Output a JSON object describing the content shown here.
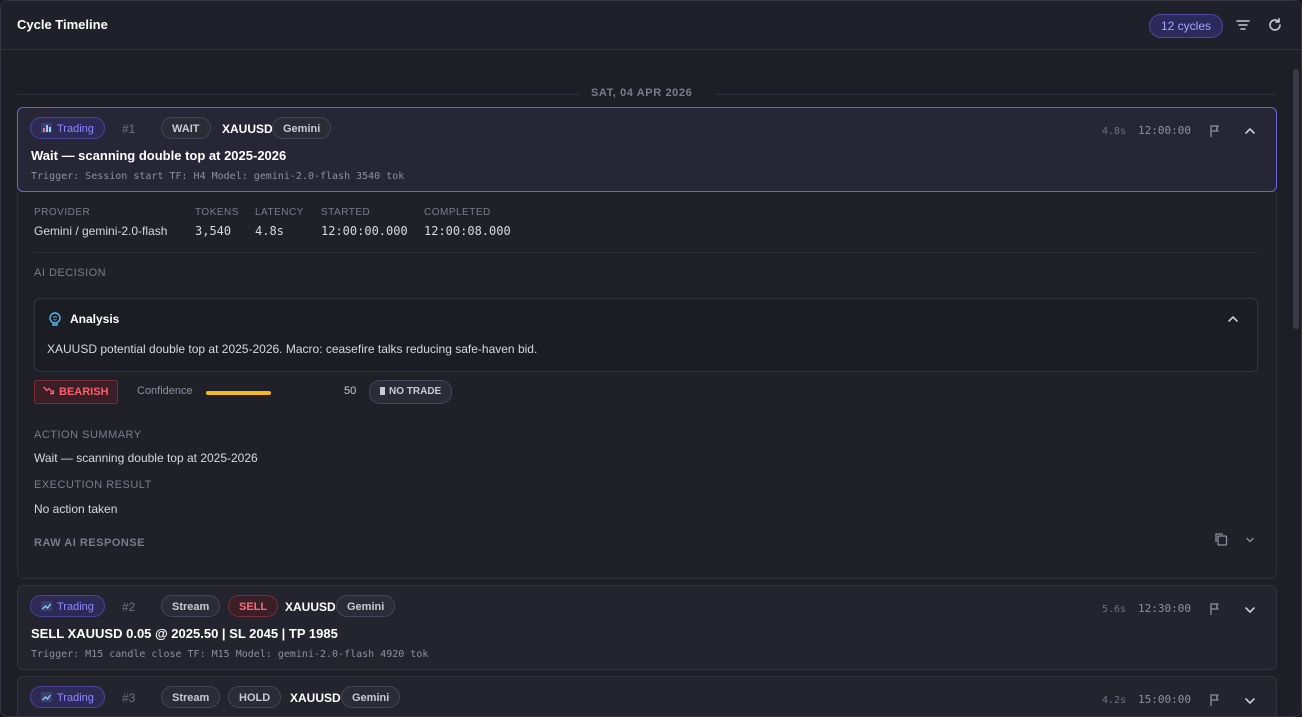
{
  "header": {
    "title": "Cycle Timeline",
    "cycles_badge": "12 cycles"
  },
  "date_divider": "SAT, 04 APR 2026",
  "cycles": [
    {
      "type": "Trading",
      "type_icon": "bar-chart-icon",
      "index": "#1",
      "badges": [
        "WAIT"
      ],
      "symbol": "XAUUSD",
      "provider": "Gemini",
      "title": "Wait — scanning double top at 2025-2026",
      "meta": "Trigger: Session start  TF: H4  Model: gemini-2.0-flash  3540 tok",
      "latency": "4.8s",
      "time": "12:00:00"
    },
    {
      "type": "Trading",
      "type_icon": "trend-chart-icon",
      "index": "#2",
      "badges": [
        "Stream",
        "SELL"
      ],
      "symbol": "XAUUSD",
      "provider": "Gemini",
      "title": "SELL XAUUSD 0.05 @ 2025.50 | SL 2045 | TP 1985",
      "meta": "Trigger: M15 candle close  TF: M15  Model: gemini-2.0-flash  4920 tok",
      "latency": "5.6s",
      "time": "12:30:00"
    },
    {
      "type": "Trading",
      "type_icon": "trend-chart-icon",
      "index": "#3",
      "badges": [
        "Stream",
        "HOLD"
      ],
      "symbol": "XAUUSD",
      "provider": "Gemini",
      "latency": "4.2s",
      "time": "15:00:00"
    }
  ],
  "details": {
    "labels": {
      "provider": "PROVIDER",
      "tokens": "TOKENS",
      "latency": "LATENCY",
      "started": "STARTED",
      "completed": "COMPLETED"
    },
    "provider": "Gemini / gemini-2.0-flash",
    "tokens": "3,540",
    "latency": "4.8s",
    "started": "12:00:00.000",
    "completed": "12:00:08.000",
    "ai_decision_label": "AI DECISION",
    "analysis_title": "Analysis",
    "analysis_text": "XAUUSD potential double top at 2025-2026. Macro: ceasefire talks reducing safe-haven bid.",
    "sentiment": "BEARISH",
    "confidence_label": "Confidence",
    "confidence_value": "50",
    "confidence_fraction": 0.5,
    "trade_status": "NO TRADE",
    "action_summary_label": "ACTION SUMMARY",
    "action_summary": "Wait — scanning double top at 2025-2026",
    "execution_result_label": "EXECUTION RESULT",
    "execution_result": "No action taken",
    "raw_label": "RAW AI RESPONSE"
  },
  "colors": {
    "accent": "#8f88ff",
    "sell": "#ff6b78",
    "confidence": "#f5b81f"
  }
}
